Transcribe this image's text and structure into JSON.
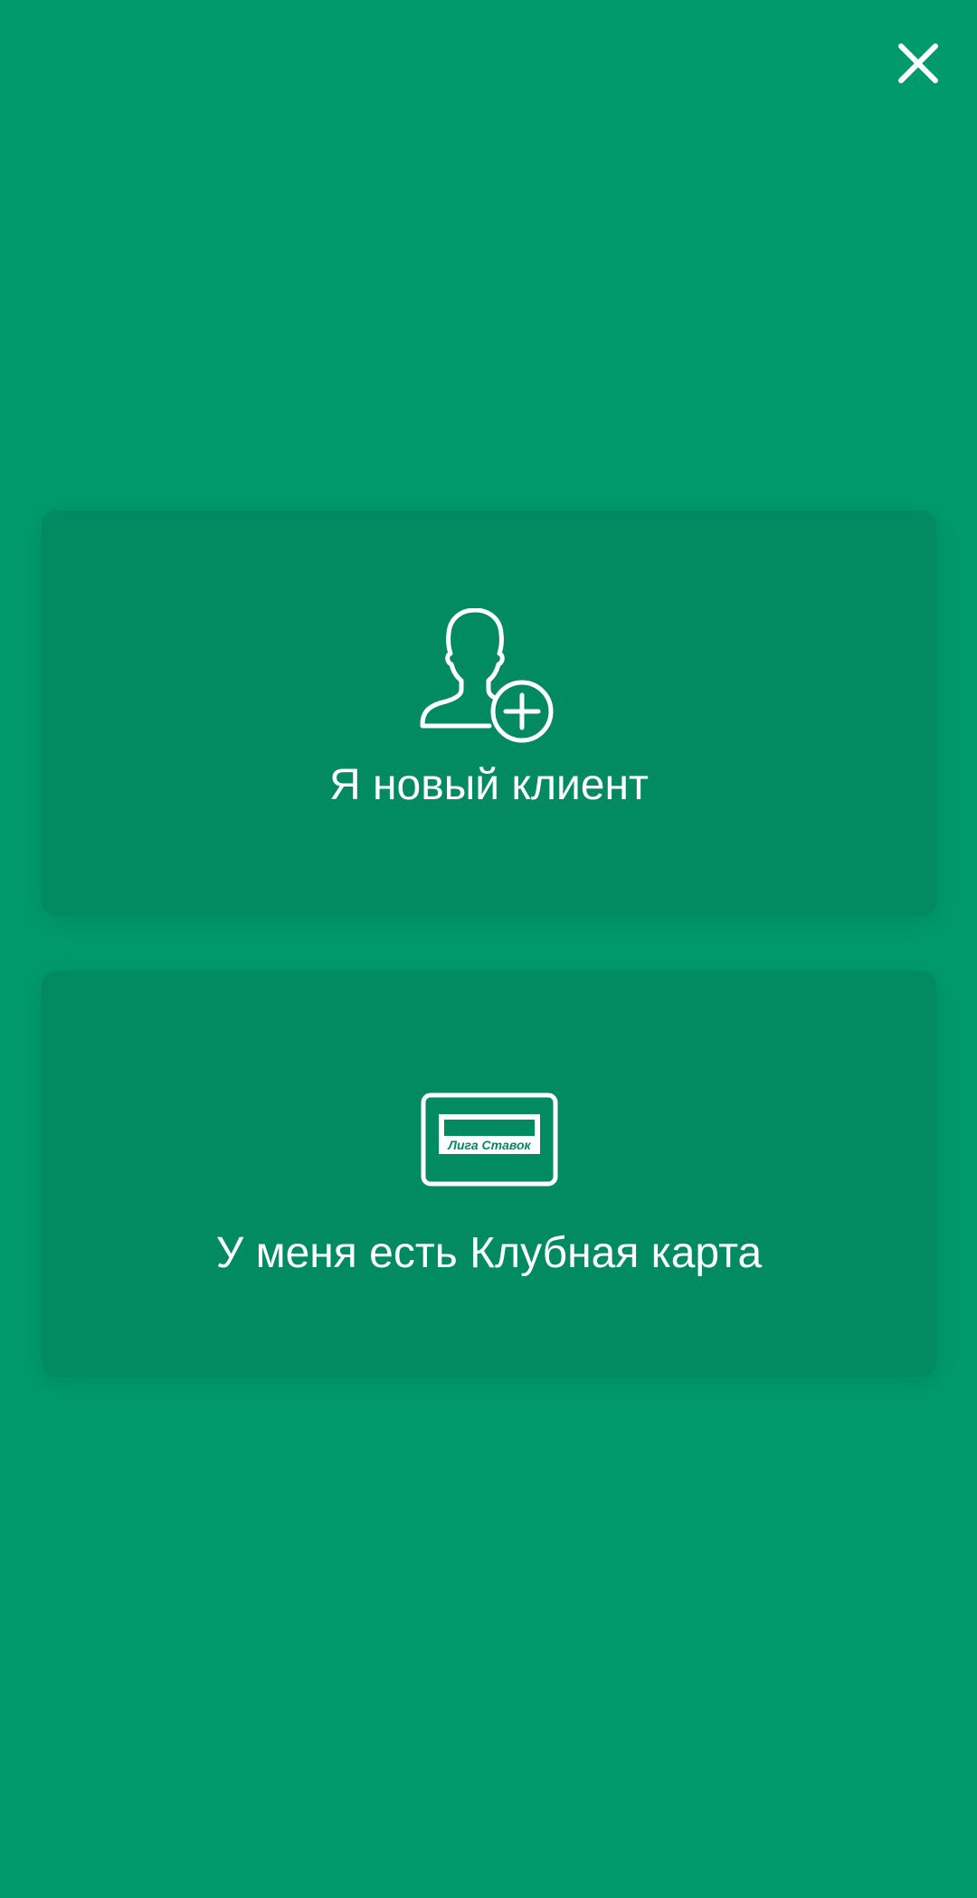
{
  "header": {
    "close_icon": "close-icon"
  },
  "options": {
    "new_client": {
      "label": "Я новый клиент",
      "icon": "add-user-icon"
    },
    "club_card": {
      "label": "У меня есть Клубная карта",
      "icon": "club-card-icon",
      "card_brand_text": "Лига Ставок"
    }
  },
  "colors": {
    "background": "#009a6d",
    "card": "#028a60",
    "foreground": "#ffffff"
  }
}
